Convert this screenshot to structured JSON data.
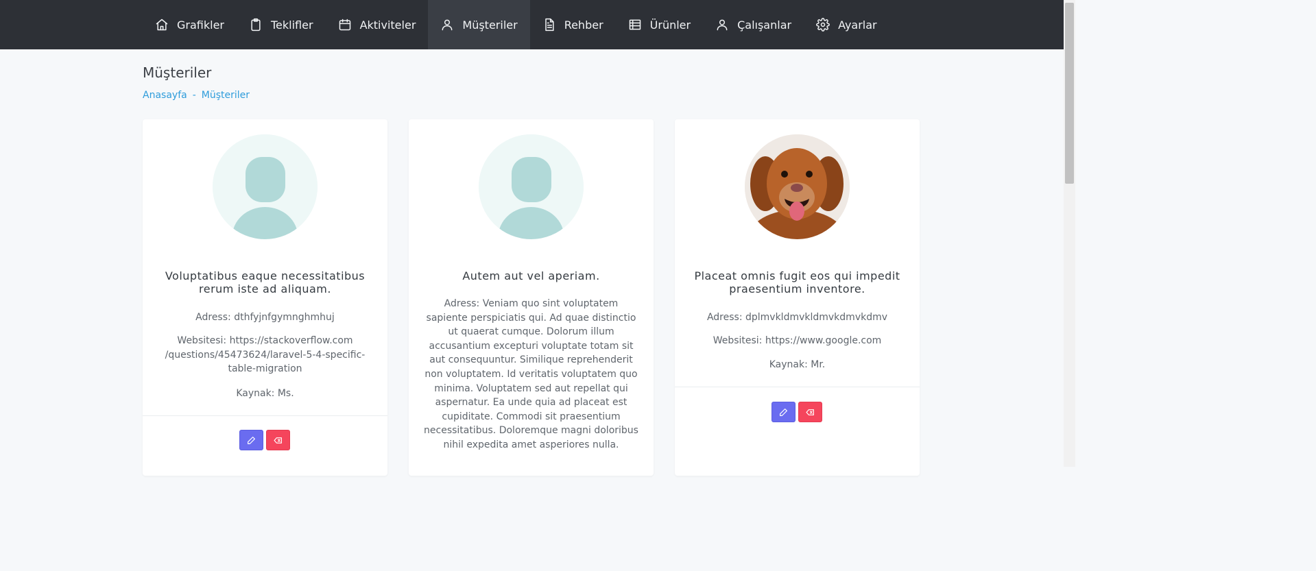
{
  "nav": {
    "items": [
      {
        "label": "Grafikler",
        "icon": "home-icon"
      },
      {
        "label": "Teklifler",
        "icon": "clipboard-icon"
      },
      {
        "label": "Aktiviteler",
        "icon": "calendar-icon"
      },
      {
        "label": "Müşteriler",
        "icon": "user-icon",
        "active": true
      },
      {
        "label": "Rehber",
        "icon": "file-text-icon"
      },
      {
        "label": "Ürünler",
        "icon": "list-icon"
      },
      {
        "label": "Çalışanlar",
        "icon": "user-icon"
      },
      {
        "label": "Ayarlar",
        "icon": "gear-icon"
      }
    ]
  },
  "page": {
    "title": "Müşteriler",
    "breadcrumb": [
      "Anasayfa",
      "-",
      "Müşteriler"
    ]
  },
  "customers": [
    {
      "avatar": "default-avatar",
      "name": "Voluptatibus eaque necessitatibus rerum iste ad aliquam.",
      "address": "Adress: dthfyjnfgymnghmhuj",
      "website": "Websitesi: https://stackoverflow.com /questions/45473624/laravel-5-4-specific-table-migration",
      "source": "Kaynak: Ms."
    },
    {
      "avatar": "default-avatar",
      "name": "Autem aut vel aperiam.",
      "address": "Adress: Veniam quo sint voluptatem sapiente perspiciatis qui. Ad quae distinctio ut quaerat cumque. Dolorum illum accusantium excepturi voluptate totam sit aut consequuntur. Similique reprehenderit non voluptatem. Id veritatis voluptatem quo minima. Voluptatem sed aut repellat qui aspernatur. Ea unde quia ad placeat est cupiditate. Commodi sit praesentium necessitatibus. Doloremque magni doloribus nihil expedita amet asperiores nulla."
    },
    {
      "avatar": "dog-photo",
      "name": "Placeat omnis fugit eos qui impedit praesentium inventore.",
      "address": "Adress: dplmvkldmvkldmvkdmvkdmv",
      "website": "Websitesi: https://www.google.com",
      "source": "Kaynak: Mr."
    }
  ],
  "colors": {
    "topbar": "#2d3036",
    "link": "#2e9cdb",
    "edit": "#6a6cf0",
    "delete": "#f5455c"
  }
}
